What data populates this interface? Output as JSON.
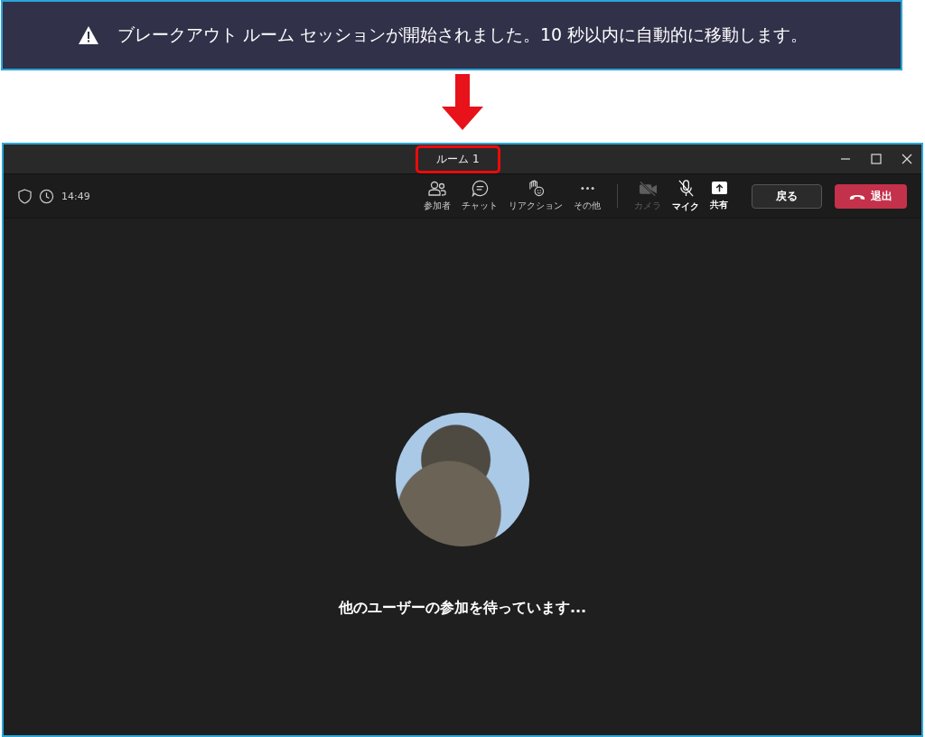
{
  "banner": {
    "text": "ブレークアウト ルーム セッションが開始されました。10 秒以内に自動的に移動します。"
  },
  "window": {
    "title": "ルーム 1",
    "title_highlighted": true
  },
  "toolbar": {
    "time": "14:49",
    "items": [
      {
        "kind": "people",
        "label": "参加者",
        "disabled": false
      },
      {
        "kind": "chat",
        "label": "チャット",
        "disabled": false
      },
      {
        "kind": "reaction",
        "label": "リアクション",
        "disabled": false
      },
      {
        "kind": "more",
        "label": "その他",
        "disabled": false
      },
      {
        "kind": "camera",
        "label": "カメラ",
        "disabled": true
      },
      {
        "kind": "mic",
        "label": "マイク",
        "disabled": false
      },
      {
        "kind": "share",
        "label": "共有",
        "disabled": false
      }
    ],
    "back_button": "戻る",
    "leave_button": "退出"
  },
  "stage": {
    "message": "他のユーザーの参加を待っています..."
  }
}
